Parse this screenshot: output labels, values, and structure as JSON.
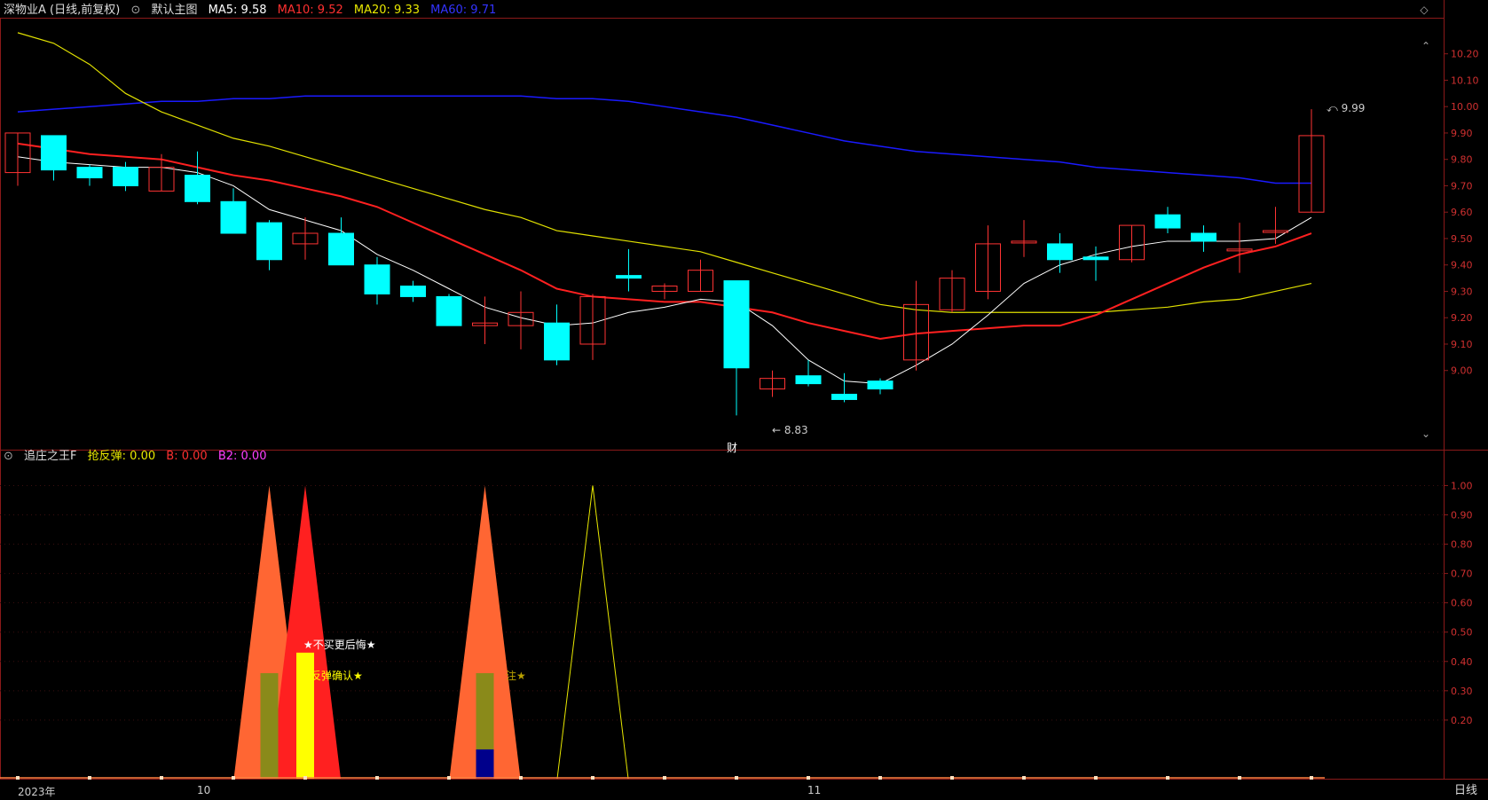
{
  "main_header": {
    "stock_label": "深物业A (日线,前复权)",
    "indicator_label": "默认主图",
    "ma5": "MA5: 9.58",
    "ma10": "MA10: 9.52",
    "ma20": "MA20: 9.33",
    "ma60": "MA60: 9.71"
  },
  "sub_header": {
    "indicator_label": "追庄之王F",
    "v1": "抢反弹: 0.00",
    "v2": "B: 0.00",
    "v3": "B2: 0.00"
  },
  "price_axis_ticks": [
    "10.20",
    "10.10",
    "10.00",
    "9.90",
    "9.80",
    "9.70",
    "9.60",
    "9.50",
    "9.40",
    "9.30",
    "9.20",
    "9.10",
    "9.00"
  ],
  "sub_axis_ticks": [
    "1.00",
    "0.90",
    "0.80",
    "0.70",
    "0.60",
    "0.50",
    "0.40",
    "0.30",
    "0.20"
  ],
  "date_labels": [
    "2023年",
    "10",
    "11"
  ],
  "period_button": "日线",
  "annotations": {
    "high_marker": "9.99",
    "low_marker": "8.83",
    "finance_mark": "财",
    "tip1": "★不买更后悔★",
    "tip2": "反弹确认★",
    "tip3": "注★"
  },
  "colors": {
    "up": "#ff3333",
    "down": "#00ffff",
    "ma5": "#ffffff",
    "ma10": "#ff2020",
    "ma20": "#e0e000",
    "ma60": "#1a1aff",
    "axis": "#8b1a1a"
  },
  "chart_data": {
    "type": "candlestick",
    "ohlc": [
      {
        "o": 9.75,
        "h": 9.9,
        "l": 9.7,
        "c": 9.9
      },
      {
        "o": 9.89,
        "h": 9.89,
        "l": 9.72,
        "c": 9.76
      },
      {
        "o": 9.77,
        "h": 9.78,
        "l": 9.7,
        "c": 9.73
      },
      {
        "o": 9.77,
        "h": 9.79,
        "l": 9.68,
        "c": 9.7
      },
      {
        "o": 9.68,
        "h": 9.82,
        "l": 9.68,
        "c": 9.77
      },
      {
        "o": 9.74,
        "h": 9.83,
        "l": 9.63,
        "c": 9.64
      },
      {
        "o": 9.64,
        "h": 9.69,
        "l": 9.52,
        "c": 9.52
      },
      {
        "o": 9.56,
        "h": 9.57,
        "l": 9.38,
        "c": 9.42
      },
      {
        "o": 9.48,
        "h": 9.58,
        "l": 9.42,
        "c": 9.52
      },
      {
        "o": 9.52,
        "h": 9.58,
        "l": 9.4,
        "c": 9.4
      },
      {
        "o": 9.4,
        "h": 9.43,
        "l": 9.25,
        "c": 9.29
      },
      {
        "o": 9.32,
        "h": 9.34,
        "l": 9.26,
        "c": 9.28
      },
      {
        "o": 9.28,
        "h": 9.29,
        "l": 9.17,
        "c": 9.17
      },
      {
        "o": 9.17,
        "h": 9.28,
        "l": 9.1,
        "c": 9.18
      },
      {
        "o": 9.17,
        "h": 9.3,
        "l": 9.08,
        "c": 9.22
      },
      {
        "o": 9.18,
        "h": 9.25,
        "l": 9.02,
        "c": 9.04
      },
      {
        "o": 9.1,
        "h": 9.29,
        "l": 9.04,
        "c": 9.28
      },
      {
        "o": 9.36,
        "h": 9.46,
        "l": 9.3,
        "c": 9.35
      },
      {
        "o": 9.3,
        "h": 9.33,
        "l": 9.27,
        "c": 9.32
      },
      {
        "o": 9.3,
        "h": 9.42,
        "l": 9.3,
        "c": 9.38
      },
      {
        "o": 9.34,
        "h": 9.34,
        "l": 8.83,
        "c": 9.01
      },
      {
        "o": 8.93,
        "h": 9.0,
        "l": 8.9,
        "c": 8.97
      },
      {
        "o": 8.98,
        "h": 9.04,
        "l": 8.94,
        "c": 8.95
      },
      {
        "o": 8.91,
        "h": 8.99,
        "l": 8.88,
        "c": 8.89
      },
      {
        "o": 8.96,
        "h": 8.97,
        "l": 8.91,
        "c": 8.93
      },
      {
        "o": 9.04,
        "h": 9.34,
        "l": 9.0,
        "c": 9.25
      },
      {
        "o": 9.23,
        "h": 9.38,
        "l": 9.22,
        "c": 9.35
      },
      {
        "o": 9.3,
        "h": 9.55,
        "l": 9.27,
        "c": 9.48
      },
      {
        "o": 9.49,
        "h": 9.57,
        "l": 9.43,
        "c": 9.49
      },
      {
        "o": 9.48,
        "h": 9.52,
        "l": 9.37,
        "c": 9.42
      },
      {
        "o": 9.43,
        "h": 9.47,
        "l": 9.34,
        "c": 9.42
      },
      {
        "o": 9.42,
        "h": 9.55,
        "l": 9.41,
        "c": 9.55
      },
      {
        "o": 9.59,
        "h": 9.62,
        "l": 9.52,
        "c": 9.54
      },
      {
        "o": 9.52,
        "h": 9.55,
        "l": 9.45,
        "c": 9.49
      },
      {
        "o": 9.46,
        "h": 9.56,
        "l": 9.37,
        "c": 9.46
      },
      {
        "o": 9.53,
        "h": 9.62,
        "l": 9.48,
        "c": 9.53
      },
      {
        "o": 9.6,
        "h": 9.99,
        "l": 9.6,
        "c": 9.89
      }
    ],
    "ma5": [
      9.81,
      9.79,
      9.78,
      9.77,
      9.77,
      9.75,
      9.7,
      9.61,
      9.57,
      9.53,
      9.44,
      9.38,
      9.31,
      9.24,
      9.2,
      9.17,
      9.18,
      9.22,
      9.24,
      9.27,
      9.26,
      9.17,
      9.04,
      8.96,
      8.95,
      9.02,
      9.1,
      9.21,
      9.33,
      9.4,
      9.44,
      9.47,
      9.49,
      9.49,
      9.49,
      9.5,
      9.58
    ],
    "ma10": [
      9.86,
      9.84,
      9.82,
      9.81,
      9.8,
      9.77,
      9.74,
      9.72,
      9.69,
      9.66,
      9.62,
      9.56,
      9.5,
      9.44,
      9.38,
      9.31,
      9.28,
      9.27,
      9.26,
      9.26,
      9.24,
      9.22,
      9.18,
      9.15,
      9.12,
      9.14,
      9.15,
      9.16,
      9.17,
      9.17,
      9.21,
      9.27,
      9.33,
      9.39,
      9.44,
      9.47,
      9.52
    ],
    "ma20": [
      10.28,
      10.24,
      10.16,
      10.05,
      9.98,
      9.93,
      9.88,
      9.85,
      9.81,
      9.77,
      9.73,
      9.69,
      9.65,
      9.61,
      9.58,
      9.53,
      9.51,
      9.49,
      9.47,
      9.45,
      9.41,
      9.37,
      9.33,
      9.29,
      9.25,
      9.23,
      9.22,
      9.22,
      9.22,
      9.22,
      9.22,
      9.23,
      9.24,
      9.26,
      9.27,
      9.3,
      9.33
    ],
    "ma60": [
      9.98,
      9.99,
      10.0,
      10.01,
      10.02,
      10.02,
      10.03,
      10.03,
      10.04,
      10.04,
      10.04,
      10.04,
      10.04,
      10.04,
      10.04,
      10.03,
      10.03,
      10.02,
      10.0,
      9.98,
      9.96,
      9.93,
      9.9,
      9.87,
      9.85,
      9.83,
      9.82,
      9.81,
      9.8,
      9.79,
      9.77,
      9.76,
      9.75,
      9.74,
      9.73,
      9.71,
      9.71
    ],
    "price_range": [
      8.7,
      10.33
    ],
    "sub_range": [
      0,
      1.08
    ],
    "sub_indicator": {
      "orange_peaks": [
        {
          "index": 7,
          "value": 1.0
        },
        {
          "index": 13,
          "value": 1.0
        }
      ],
      "red_peak": {
        "index": 8,
        "value": 1.0
      },
      "yellow_peak": {
        "index": 16,
        "value": 1.0
      },
      "olive_bars": [
        {
          "index": 7,
          "value": 0.36
        },
        {
          "index": 13,
          "value": 0.36
        }
      ],
      "yellow_bar": {
        "index": 8,
        "value": 0.43
      },
      "navy_bar": {
        "index": 13,
        "value": 0.1
      }
    }
  }
}
